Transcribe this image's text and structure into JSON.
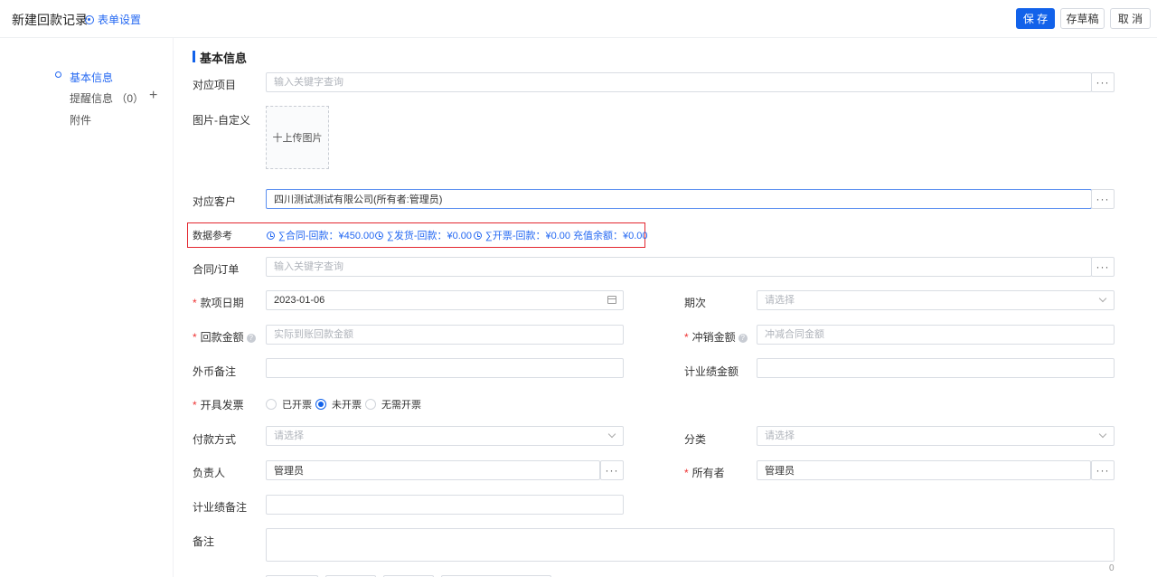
{
  "header": {
    "title": "新建回款记录",
    "form_settings": "表单设置",
    "save": "保 存",
    "draft": "存草稿",
    "cancel": "取 消"
  },
  "sidebar": {
    "items": [
      {
        "label": "基本信息"
      },
      {
        "label": "提醒信息"
      },
      {
        "label": "附件"
      }
    ],
    "reminder_count": "（0）",
    "add_symbol": "+"
  },
  "section_title": "基本信息",
  "form": {
    "project": {
      "label": "对应项目",
      "placeholder": "输入关键字查询"
    },
    "image": {
      "label": "图片-自定义",
      "upload": "十上传图片"
    },
    "customer": {
      "label": "对应客户",
      "value": "四川测试测试有限公司(所有者:管理员)"
    },
    "data_ref": {
      "label": "数据参考",
      "items": [
        {
          "text": "∑合同-回款：¥450.00"
        },
        {
          "text": "∑发货-回款：¥0.00"
        },
        {
          "text": "∑开票-回款：¥0.00"
        },
        {
          "text": "充值余额：¥0.00"
        }
      ]
    },
    "contract": {
      "label": "合同/订单",
      "placeholder": "输入关键字查询"
    },
    "date": {
      "label": "款项日期",
      "value": "2023-01-06"
    },
    "period": {
      "label": "期次",
      "placeholder": "请选择"
    },
    "amount": {
      "label": "回款金额",
      "placeholder": "实际到账回款金额"
    },
    "offset": {
      "label": "冲销金额",
      "placeholder": "冲减合同金额"
    },
    "foreign_note": {
      "label": "外币备注"
    },
    "performance_amount": {
      "label": "计业绩金额"
    },
    "invoice": {
      "label": "开具发票",
      "options": [
        {
          "label": "已开票",
          "checked": false
        },
        {
          "label": "未开票",
          "checked": true
        },
        {
          "label": "无需开票",
          "checked": false
        }
      ]
    },
    "payment_method": {
      "label": "付款方式",
      "placeholder": "请选择"
    },
    "category": {
      "label": "分类",
      "placeholder": "请选择"
    },
    "responsible": {
      "label": "负责人",
      "value": "管理员"
    },
    "owner": {
      "label": "所有者",
      "value": "管理员"
    },
    "performance_note": {
      "label": "计业绩备注"
    },
    "remark": {
      "label": "备注",
      "counter": "0"
    }
  },
  "more_symbol": "···",
  "required_mark": "*",
  "colors": {
    "primary": "#1262ea",
    "link": "#2468f2",
    "highlight_border": "#e3262f",
    "required": "#e33333"
  }
}
